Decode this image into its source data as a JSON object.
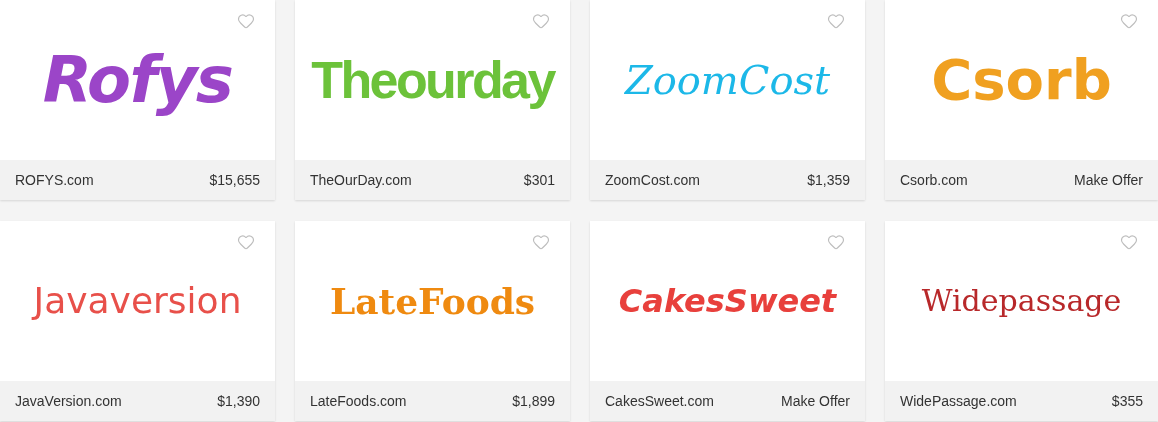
{
  "listings": [
    {
      "logo": "Rofys",
      "color": "#9b45c8",
      "domain": "ROFYS.com",
      "price": "$15,655",
      "favorite": false
    },
    {
      "logo": "Theourday",
      "color": "#6cc23a",
      "domain": "TheOurDay.com",
      "price": "$301",
      "favorite": false
    },
    {
      "logo": "ZoomCost",
      "color": "#1cb8e8",
      "domain": "ZoomCost.com",
      "price": "$1,359",
      "favorite": false
    },
    {
      "logo": "Csorb",
      "color": "#f0a020",
      "domain": "Csorb.com",
      "price": "Make Offer",
      "favorite": false
    },
    {
      "logo": "Javaversion",
      "color": "#e8504a",
      "domain": "JavaVersion.com",
      "price": "$1,390",
      "favorite": false
    },
    {
      "logo": "LateFoods",
      "color": "#ef8a10",
      "domain": "LateFoods.com",
      "price": "$1,899",
      "favorite": false
    },
    {
      "logo": "CakesSweet",
      "color": "#e8403c",
      "domain": "CakesSweet.com",
      "price": "Make Offer",
      "favorite": false
    },
    {
      "logo": "Widepassage",
      "color": "#b8282a",
      "domain": "WidePassage.com",
      "price": "$355",
      "favorite": false
    }
  ]
}
